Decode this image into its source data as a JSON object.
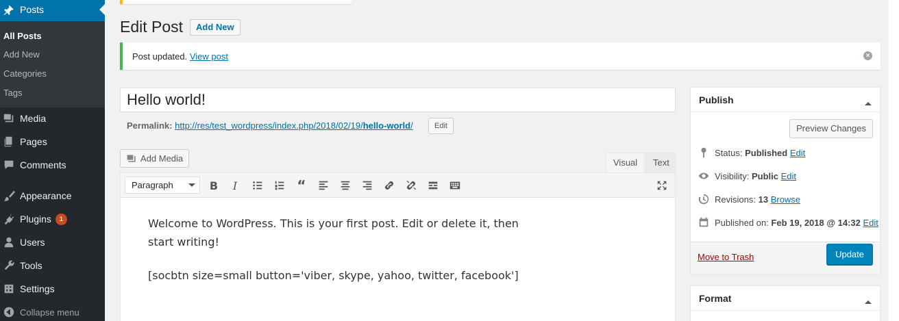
{
  "sidebar": {
    "items": [
      {
        "label": "Posts",
        "icon": "pushpin-icon"
      },
      {
        "label": "Media",
        "icon": "media-icon"
      },
      {
        "label": "Pages",
        "icon": "pages-icon"
      },
      {
        "label": "Comments",
        "icon": "comments-icon"
      },
      {
        "label": "Appearance",
        "icon": "brush-icon"
      },
      {
        "label": "Plugins",
        "icon": "plugin-icon",
        "badge": "1"
      },
      {
        "label": "Users",
        "icon": "users-icon"
      },
      {
        "label": "Tools",
        "icon": "wrench-icon"
      },
      {
        "label": "Settings",
        "icon": "settings-icon"
      },
      {
        "label": "Collapse menu",
        "icon": "collapse-icon"
      }
    ],
    "submenu": [
      "All Posts",
      "Add New",
      "Categories",
      "Tags"
    ]
  },
  "header": {
    "title": "Edit Post",
    "add_new": "Add New"
  },
  "notice": {
    "text": "Post updated.",
    "link": "View post"
  },
  "post": {
    "title": "Hello world!",
    "permalink_label": "Permalink:",
    "permalink_base": "http://res/test_wordpress/index.php/2018/02/19/",
    "permalink_slug": "hello-world",
    "permalink_end": "/",
    "edit_label": "Edit"
  },
  "editor": {
    "add_media": "Add Media",
    "tab_visual": "Visual",
    "tab_text": "Text",
    "format": "Paragraph",
    "paragraph1": "Welcome to WordPress. This is your first post. Edit or delete it, then start writing!",
    "paragraph2": "[socbtn size=small button='viber, skype, yahoo, twitter, facebook']"
  },
  "publish": {
    "title": "Publish",
    "preview": "Preview Changes",
    "status_label": "Status:",
    "status_value": "Published",
    "visibility_label": "Visibility:",
    "visibility_value": "Public",
    "revisions_label": "Revisions:",
    "revisions_value": "13",
    "browse": "Browse",
    "published_label": "Published on:",
    "published_value": "Feb 19, 2018 @ 14:32",
    "edit": "Edit",
    "trash": "Move to Trash",
    "update": "Update"
  },
  "format_box": {
    "title": "Format"
  },
  "colors": {
    "accent": "#0073aa",
    "sidebar": "#23282d",
    "success": "#46b450",
    "badge": "#ca4a1f"
  }
}
